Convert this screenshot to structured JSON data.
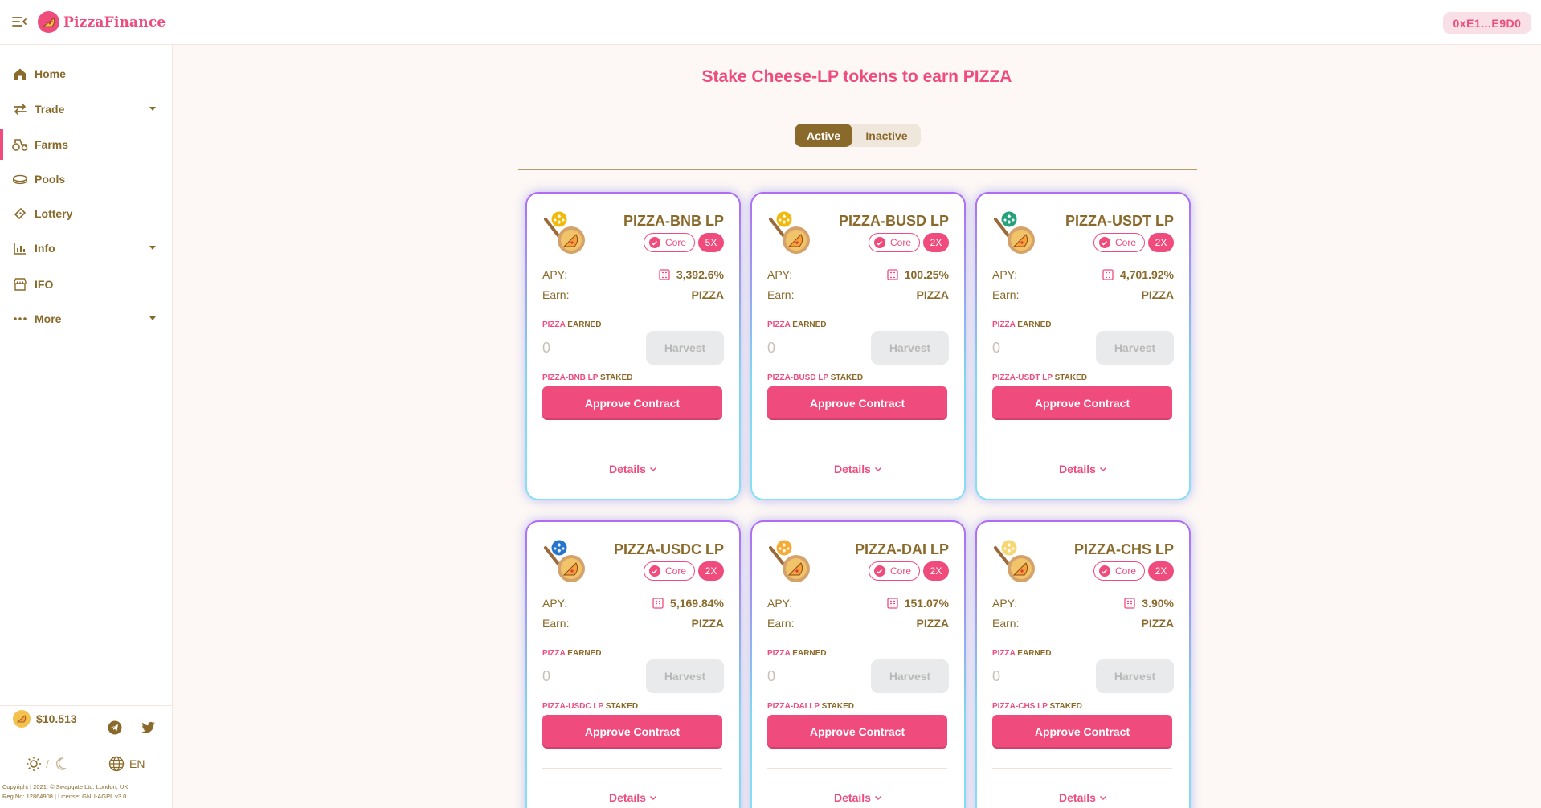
{
  "brand": {
    "name": "PizzaFinance"
  },
  "wallet": {
    "address": "0xE1...E9D0"
  },
  "sidebar": {
    "items": [
      {
        "label": "Home",
        "icon": "home-icon"
      },
      {
        "label": "Trade",
        "icon": "swap-icon"
      },
      {
        "label": "Farms",
        "icon": "tractor-icon"
      },
      {
        "label": "Pools",
        "icon": "pool-icon"
      },
      {
        "label": "Lottery",
        "icon": "ticket-icon"
      },
      {
        "label": "Info",
        "icon": "chart-icon"
      },
      {
        "label": "IFO",
        "icon": "shop-icon"
      },
      {
        "label": "More",
        "icon": "more-icon"
      }
    ],
    "price": "$10.513",
    "lang": "EN",
    "copyright_line1": "Copyright | 2021. © Swapgate Ltd. London, UK",
    "copyright_line2": "Reg No: 12864908 | License: GNU-AGPL v3.0"
  },
  "main": {
    "title": "Stake Cheese-LP tokens to earn PIZZA",
    "toggle": {
      "active": "Active",
      "inactive": "Inactive"
    }
  },
  "labels": {
    "apy": "APY:",
    "earn": "Earn:",
    "earned_token": "PIZZA",
    "earned_suffix": "EARNED",
    "staked_suffix": "STAKED",
    "harvest": "Harvest",
    "approve": "Approve Contract",
    "details": "Details",
    "core": "Core"
  },
  "farms": [
    {
      "name": "PIZZA-BNB LP",
      "multiplier": "5X",
      "apy": "3,392.6%",
      "earn": "PIZZA",
      "earned": "0",
      "staked_token": "PIZZA-BNB LP",
      "quote_color": "#f0b90b"
    },
    {
      "name": "PIZZA-BUSD LP",
      "multiplier": "2X",
      "apy": "100.25%",
      "earn": "PIZZA",
      "earned": "0",
      "staked_token": "PIZZA-BUSD LP",
      "quote_color": "#f0b90b"
    },
    {
      "name": "PIZZA-USDT LP",
      "multiplier": "2X",
      "apy": "4,701.92%",
      "earn": "PIZZA",
      "earned": "0",
      "staked_token": "PIZZA-USDT LP",
      "quote_color": "#26a17b"
    },
    {
      "name": "PIZZA-USDC LP",
      "multiplier": "2X",
      "apy": "5,169.84%",
      "earn": "PIZZA",
      "earned": "0",
      "staked_token": "PIZZA-USDC LP",
      "quote_color": "#2775ca"
    },
    {
      "name": "PIZZA-DAI LP",
      "multiplier": "2X",
      "apy": "151.07%",
      "earn": "PIZZA",
      "earned": "0",
      "staked_token": "PIZZA-DAI LP",
      "quote_color": "#f5ac37"
    },
    {
      "name": "PIZZA-CHS LP",
      "multiplier": "2X",
      "apy": "3.90%",
      "earn": "PIZZA",
      "earned": "0",
      "staked_token": "PIZZA-CHS LP",
      "quote_color": "#f7d774"
    }
  ],
  "colors": {
    "accent": "#ef4b7d",
    "brown": "#8a6a2a",
    "background": "#fdf8f5"
  }
}
